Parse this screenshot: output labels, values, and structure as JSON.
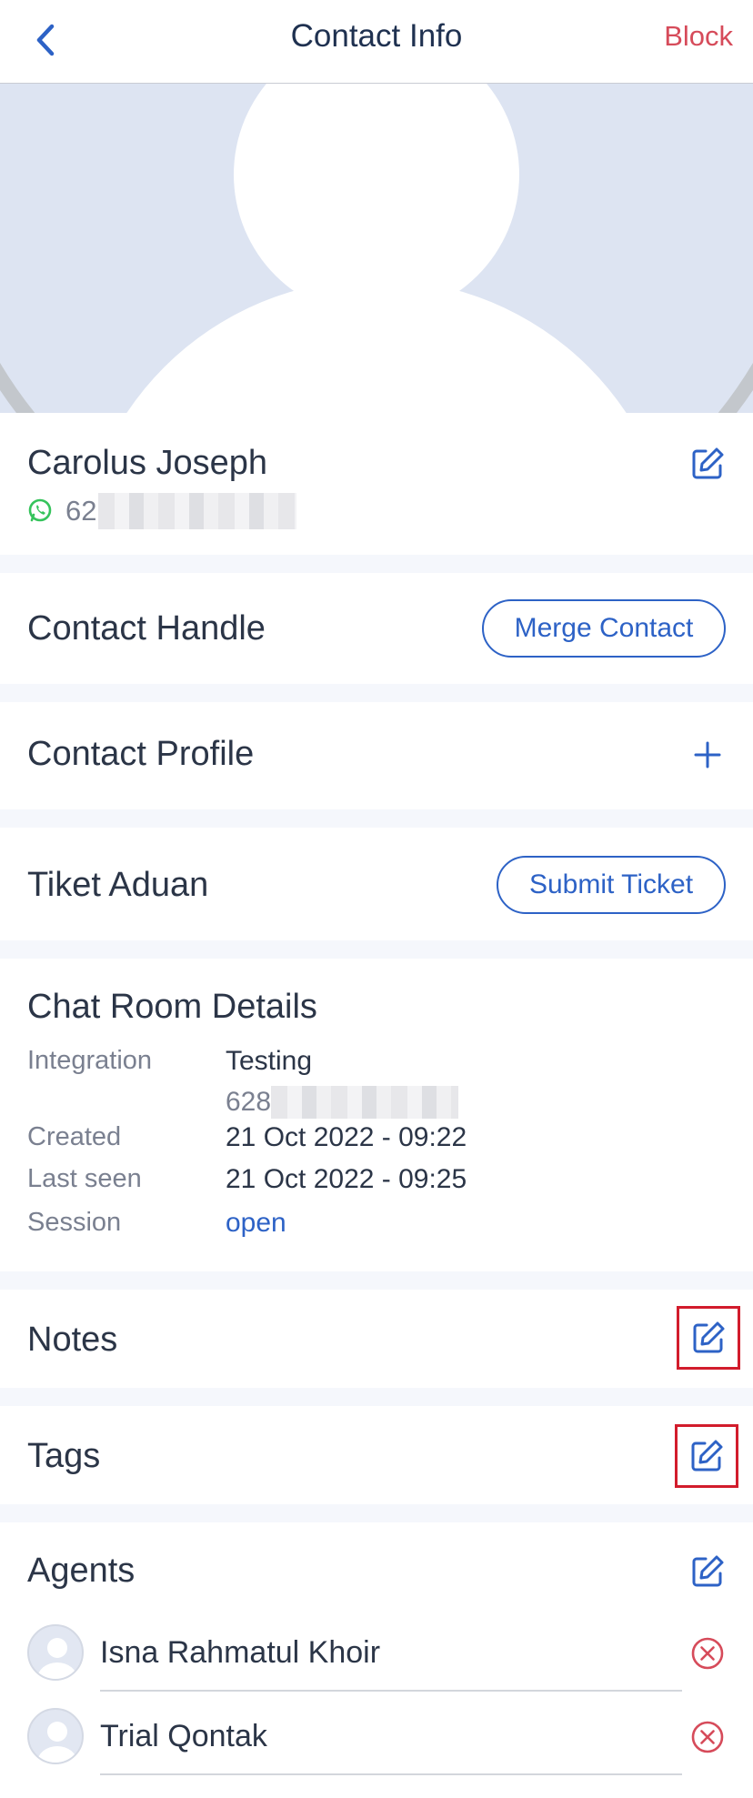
{
  "nav": {
    "title": "Contact Info",
    "block_label": "Block"
  },
  "contact": {
    "name": "Carolus Joseph",
    "phone_prefix": "62",
    "channel_icon": "whatsapp-icon"
  },
  "sections": {
    "contact_handle": {
      "title": "Contact Handle",
      "button": "Merge Contact"
    },
    "contact_profile": {
      "title": "Contact Profile"
    },
    "ticket": {
      "title": "Tiket Aduan",
      "button": "Submit Ticket"
    },
    "chat_room": {
      "title": "Chat Room Details",
      "integration_label": "Integration",
      "integration_value": "Testing",
      "integration_number_prefix": "628",
      "created_label": "Created",
      "created_value": "21 Oct 2022 - 09:22",
      "last_seen_label": "Last seen",
      "last_seen_value": "21 Oct 2022 - 09:25",
      "session_label": "Session",
      "session_value": "open"
    },
    "notes": {
      "title": "Notes"
    },
    "tags": {
      "title": "Tags"
    },
    "agents": {
      "title": "Agents",
      "items": [
        {
          "name": "Isna Rahmatul Khoir"
        },
        {
          "name": "Trial Qontak"
        }
      ]
    }
  },
  "colors": {
    "accent": "#2d62c6",
    "danger": "#d64b5a",
    "highlight": "#d21c2c",
    "whatsapp": "#35c35b"
  }
}
